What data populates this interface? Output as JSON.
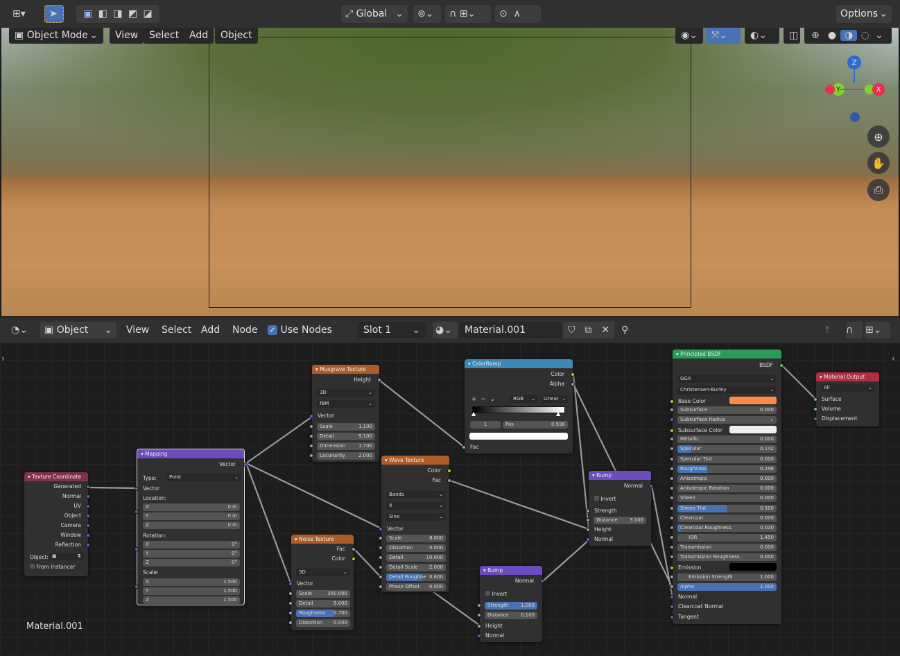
{
  "header": {
    "transform_orientation": "Global",
    "options": "Options"
  },
  "viewport": {
    "mode": "Object Mode",
    "menus": [
      "View",
      "Select",
      "Add",
      "Object"
    ]
  },
  "node_header": {
    "editor_type": "Object",
    "menus": [
      "View",
      "Select",
      "Add",
      "Node"
    ],
    "use_nodes": "Use Nodes",
    "slot": "Slot 1",
    "material": "Material.001"
  },
  "canvas_label": "Material.001",
  "nodes": {
    "texcoord": {
      "title": "Texture Coordinate",
      "outputs": [
        "Generated",
        "Normal",
        "UV",
        "Object",
        "Camera",
        "Window",
        "Reflection"
      ],
      "object_label": "Object:",
      "from_instancer": "From Instancer"
    },
    "mapping": {
      "title": "Mapping",
      "out": "Vector",
      "type_label": "Type:",
      "type": "Point",
      "vector": "Vector",
      "location": "Location:",
      "rotation": "Rotation:",
      "scale": "Scale:",
      "x": "X",
      "y": "Y",
      "z": "Z",
      "loc": [
        "0 m",
        "0 m",
        "0 m"
      ],
      "rot": [
        "0°",
        "0°",
        "0°"
      ],
      "scl": [
        "1.500",
        "1.500",
        "1.500"
      ]
    },
    "musgrave": {
      "title": "Musgrave Texture",
      "out": "Height",
      "dim": "3D",
      "type": "fBM",
      "vector": "Vector",
      "fields": [
        [
          "Scale",
          "1.100"
        ],
        [
          "Detail",
          "9.100"
        ],
        [
          "Dimension",
          "1.700"
        ],
        [
          "Lacunarity",
          "2.000"
        ]
      ]
    },
    "noise": {
      "title": "Noise Texture",
      "outs": [
        "Fac",
        "Color"
      ],
      "dim": "3D",
      "vector": "Vector",
      "fields": [
        [
          "Scale",
          "300.000"
        ],
        [
          "Detail",
          "5.000"
        ],
        [
          "Roughness",
          "0.700"
        ],
        [
          "Distortion",
          "0.000"
        ]
      ]
    },
    "wave": {
      "title": "Wave Texture",
      "outs": [
        "Color",
        "Fac"
      ],
      "dd": [
        "Bands",
        "X",
        "Sine"
      ],
      "vector": "Vector",
      "fields": [
        [
          "Scale",
          "8.000"
        ],
        [
          "Distortion",
          "5.000"
        ],
        [
          "Detail",
          "10.000"
        ],
        [
          "Detail Scale",
          "2.000"
        ],
        [
          "Detail Roughne",
          "0.600"
        ],
        [
          "Phase Offset",
          "0.000"
        ]
      ]
    },
    "ramp": {
      "title": "ColorRamp",
      "outs": [
        "Color",
        "Alpha"
      ],
      "mode": "RGB",
      "interp": "Linear",
      "index": "1",
      "pos_label": "Pos",
      "pos": "0.938",
      "fac": "Fac"
    },
    "bump1": {
      "title": "Bump",
      "out": "Normal",
      "invert": "Invert",
      "strength": "Strength",
      "distance_label": "Distance",
      "distance": "3.100",
      "height": "Height",
      "normal": "Normal"
    },
    "bump2": {
      "title": "Bump",
      "out": "Normal",
      "invert": "Invert",
      "strength_label": "Strength",
      "strength": "1.000",
      "distance_label": "Distance",
      "distance": "0.100",
      "height": "Height",
      "normal": "Normal"
    },
    "bsdf": {
      "title": "Principled BSDF",
      "out": "BSDF",
      "dist": "GGX",
      "sss": "Christensen-Burley",
      "base_color": "Base Color",
      "rows": [
        [
          "Subsurface",
          "0.000"
        ],
        [
          "Metallic",
          "0.000"
        ],
        [
          "Specular",
          "0.142"
        ],
        [
          "Specular Tint",
          "0.000"
        ],
        [
          "Roughness",
          "0.298"
        ],
        [
          "Anisotropic",
          "0.000"
        ],
        [
          "Anisotropic Rotation",
          "0.000"
        ],
        [
          "Sheen",
          "0.000"
        ],
        [
          "Sheen Tint",
          "0.500"
        ],
        [
          "Clearcoat",
          "0.000"
        ],
        [
          "Clearcoat Roughness",
          "0.030"
        ],
        [
          "IOR",
          "1.450"
        ],
        [
          "Transmission",
          "0.000"
        ],
        [
          "Transmission Roughness",
          "0.000"
        ]
      ],
      "ssr": "Subsurface Radius",
      "ssc": "Subsurface Color",
      "emission": "Emission",
      "emission_strength": [
        "Emission Strength",
        "1.000"
      ],
      "alpha": [
        "Alpha",
        "1.000"
      ],
      "normal": "Normal",
      "clearcoat_normal": "Clearcoat Normal",
      "tangent": "Tangent"
    },
    "output": {
      "title": "Material Output",
      "target": "All",
      "inputs": [
        "Surface",
        "Volume",
        "Displacement"
      ]
    }
  },
  "colors": {
    "accent": "#4772b3",
    "input_node": "#83314a",
    "vector_node": "#6c4cbf",
    "texture_node": "#ad5c27",
    "converter_node": "#3a89b9",
    "shader_node": "#2c9b58",
    "output_node": "#b02d3f",
    "base_color": "#ff8a45"
  }
}
